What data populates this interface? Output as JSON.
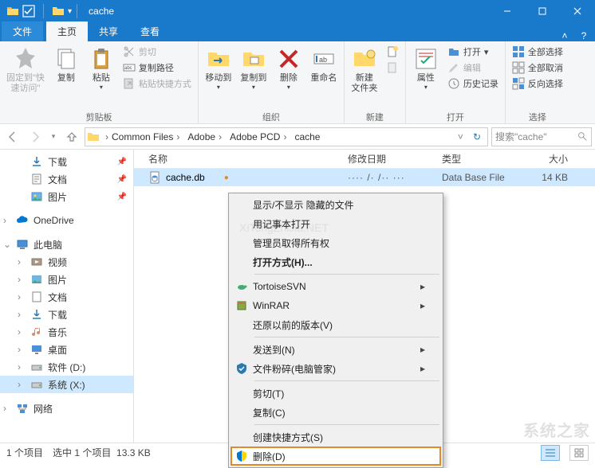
{
  "window": {
    "title": "cache"
  },
  "tabs": {
    "file": "文件",
    "home": "主页",
    "share": "共享",
    "view": "查看"
  },
  "ribbon": {
    "clipboard": {
      "pin": "固定到\"快\n速访问\"",
      "copy": "复制",
      "paste": "粘贴",
      "cut": "剪切",
      "copyPath": "复制路径",
      "pasteShortcut": "粘贴快捷方式",
      "group": "剪贴板"
    },
    "organize": {
      "moveTo": "移动到",
      "copyTo": "复制到",
      "delete": "删除",
      "rename": "重命名",
      "group": "组织"
    },
    "new": {
      "newFolder": "新建\n文件夹",
      "group": "新建"
    },
    "open": {
      "properties": "属性",
      "open": "打开",
      "edit": "编辑",
      "history": "历史记录",
      "group": "打开"
    },
    "select": {
      "selectAll": "全部选择",
      "selectNone": "全部取消",
      "invert": "反向选择",
      "group": "选择"
    }
  },
  "breadcrumb": [
    "Common Files",
    "Adobe",
    "Adobe PCD",
    "cache"
  ],
  "searchPlaceholder": "搜索\"cache\"",
  "columns": {
    "name": "名称",
    "date": "修改日期",
    "type": "类型",
    "size": "大小"
  },
  "file": {
    "name": "cache.db",
    "date": "···· /· /·· ···",
    "type": "Data Base File",
    "size": "14 KB"
  },
  "sidebar": {
    "downloads": "下载",
    "documents": "文档",
    "pictures": "图片",
    "onedrive": "OneDrive",
    "thispc": "此电脑",
    "videos": "视频",
    "pictures2": "图片",
    "documents2": "文档",
    "downloads2": "下载",
    "music": "音乐",
    "desktop": "桌面",
    "driveD": "软件 (D:)",
    "driveX": "系统 (X:)",
    "network": "网络"
  },
  "statusbar": {
    "count": "1 个项目",
    "selected": "选中 1 个项目",
    "size": "13.3 KB"
  },
  "contextMenu": {
    "showHide": "显示/不显示 隐藏的文件",
    "openNotepad": "用记事本打开",
    "adminTake": "管理员取得所有权",
    "openWith": "打开方式(H)...",
    "tortoise": "TortoiseSVN",
    "winrar": "WinRAR",
    "restore": "还原以前的版本(V)",
    "sendTo": "发送到(N)",
    "shred": "文件粉碎(电脑管家)",
    "cut": "剪切(T)",
    "copy": "复制(C)",
    "shortcut": "创建快捷方式(S)",
    "delete": "删除(D)"
  },
  "watermark": "系统之家",
  "watermarkCenter": "XiTongZhiJia.NET"
}
